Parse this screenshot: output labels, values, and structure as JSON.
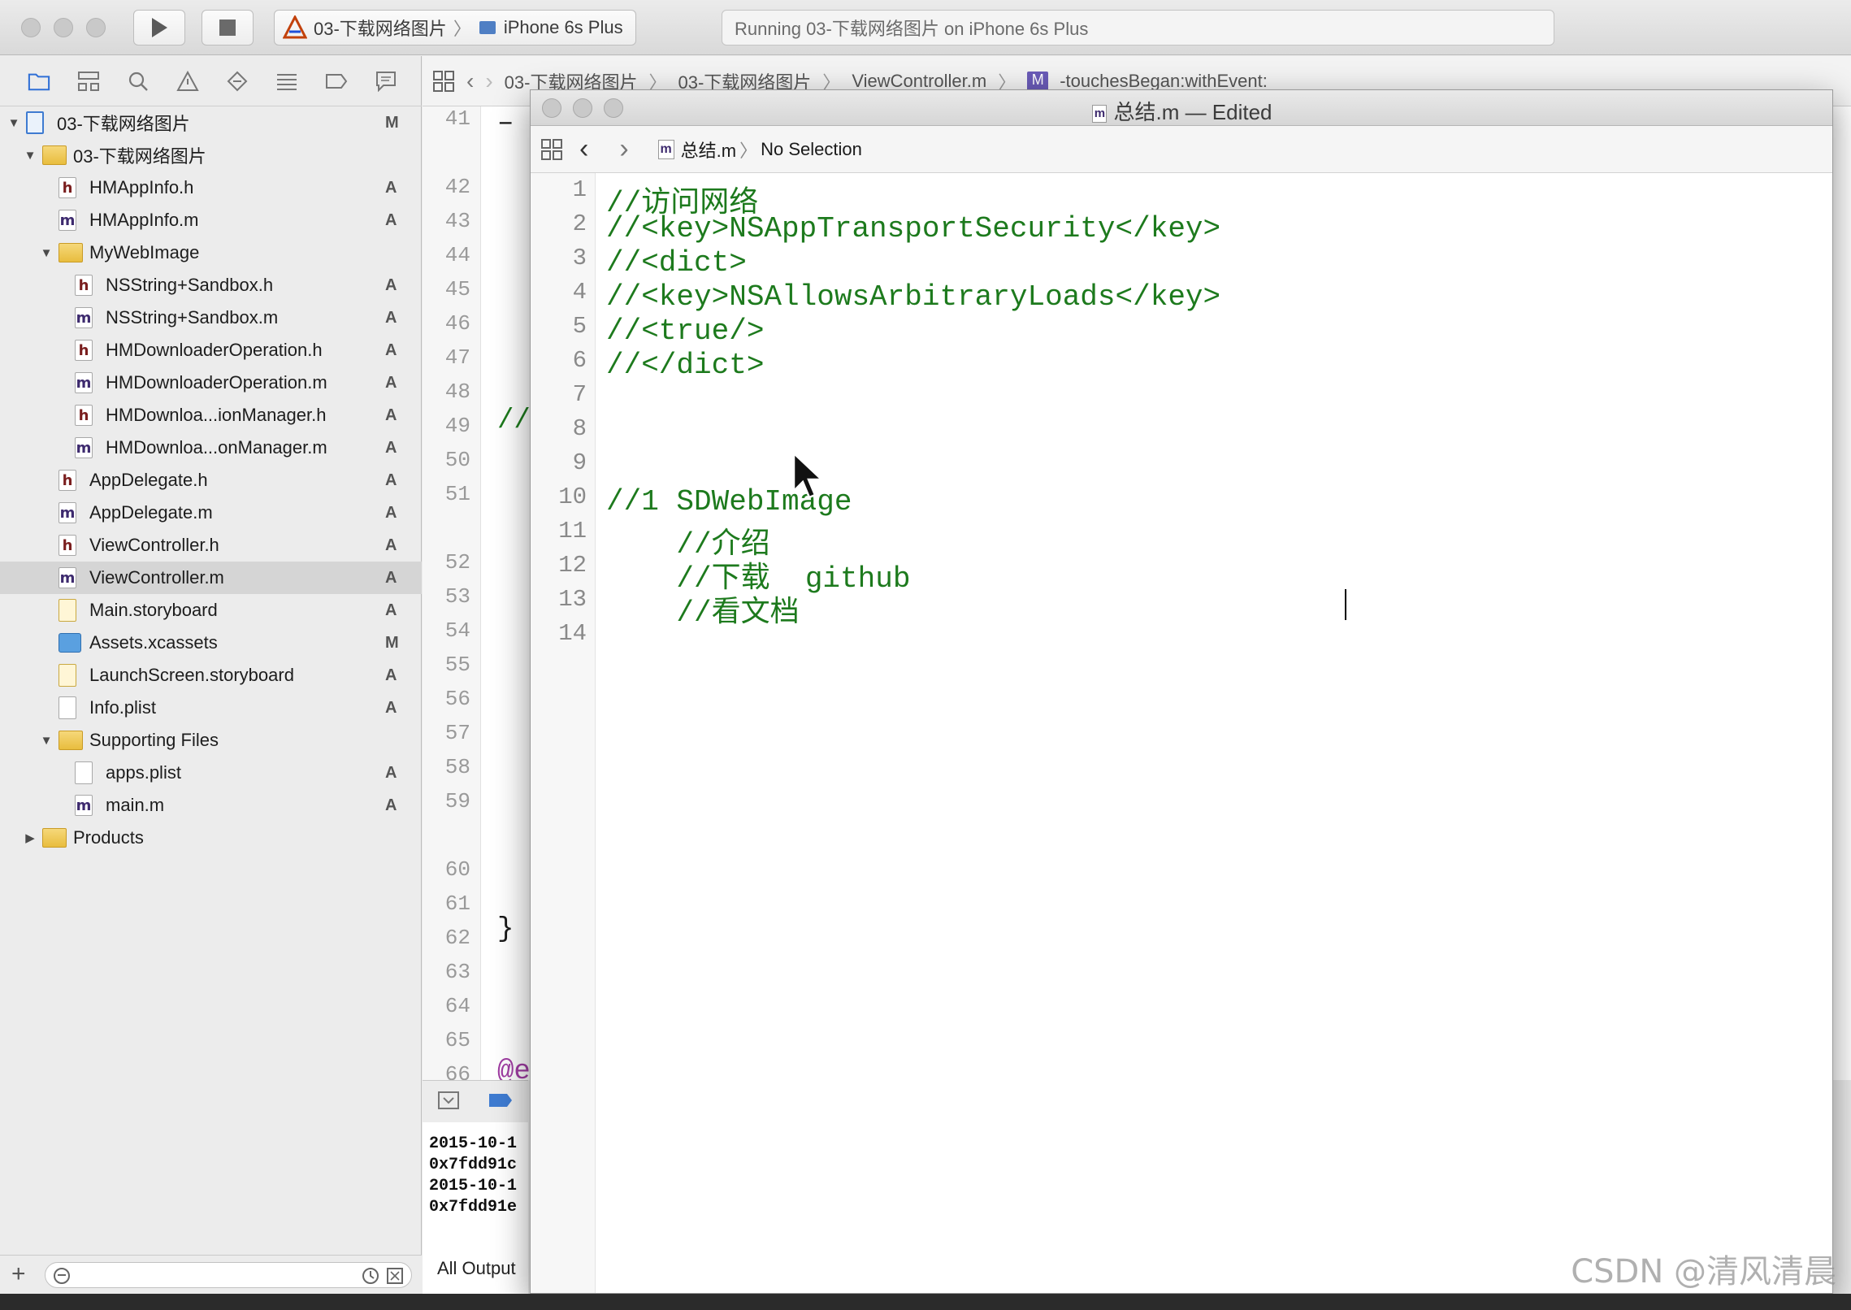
{
  "toolbar": {
    "scheme_project": "03-下载网络图片",
    "scheme_device": "iPhone 6s Plus",
    "activity_status": "Running 03-下载网络图片 on iPhone 6s Plus"
  },
  "bg_editor": {
    "jumpbar": {
      "crumbs": [
        "03-下载网络图片",
        "03-下载网络图片",
        "ViewController.m",
        "-touchesBegan:withEvent:"
      ]
    },
    "line_numbers": [
      "41",
      "42",
      "43",
      "44",
      "45",
      "46",
      "47",
      "48",
      "49",
      "50",
      "51",
      "52",
      "53",
      "54",
      "55",
      "56",
      "57",
      "58",
      "59",
      "60",
      "61",
      "62",
      "63",
      "64",
      "65",
      "66"
    ],
    "code_fragments": {
      "dash": "–",
      "comment": "//",
      "brace": "}",
      "at": "@e"
    },
    "console_lines": [
      "2015-10-1",
      "0x7fdd91c",
      "2015-10-1",
      "0x7fdd91e"
    ],
    "all_output_label": "All Output"
  },
  "navigator": {
    "tree": [
      {
        "label": "03-下载网络图片",
        "badge": "M",
        "kind": "project"
      },
      {
        "label": "03-下载网络图片",
        "badge": "",
        "kind": "folder"
      },
      {
        "label": "HMAppInfo.h",
        "badge": "A",
        "kind": "h"
      },
      {
        "label": "HMAppInfo.m",
        "badge": "A",
        "kind": "m"
      },
      {
        "label": "MyWebImage",
        "badge": "",
        "kind": "folder"
      },
      {
        "label": "NSString+Sandbox.h",
        "badge": "A",
        "kind": "h"
      },
      {
        "label": "NSString+Sandbox.m",
        "badge": "A",
        "kind": "m"
      },
      {
        "label": "HMDownloaderOperation.h",
        "badge": "A",
        "kind": "h"
      },
      {
        "label": "HMDownloaderOperation.m",
        "badge": "A",
        "kind": "m"
      },
      {
        "label": "HMDownloa...ionManager.h",
        "badge": "A",
        "kind": "h"
      },
      {
        "label": "HMDownloa...onManager.m",
        "badge": "A",
        "kind": "m"
      },
      {
        "label": "AppDelegate.h",
        "badge": "A",
        "kind": "h"
      },
      {
        "label": "AppDelegate.m",
        "badge": "A",
        "kind": "m"
      },
      {
        "label": "ViewController.h",
        "badge": "A",
        "kind": "h"
      },
      {
        "label": "ViewController.m",
        "badge": "A",
        "kind": "m"
      },
      {
        "label": "Main.storyboard",
        "badge": "A",
        "kind": "storyboard"
      },
      {
        "label": "Assets.xcassets",
        "badge": "M",
        "kind": "assets"
      },
      {
        "label": "LaunchScreen.storyboard",
        "badge": "A",
        "kind": "storyboard"
      },
      {
        "label": "Info.plist",
        "badge": "A",
        "kind": "plist"
      },
      {
        "label": "Supporting Files",
        "badge": "",
        "kind": "folder"
      },
      {
        "label": "apps.plist",
        "badge": "A",
        "kind": "plist"
      },
      {
        "label": "main.m",
        "badge": "A",
        "kind": "m"
      },
      {
        "label": "Products",
        "badge": "",
        "kind": "folder"
      }
    ]
  },
  "doc_window": {
    "title": "总结.m — Edited",
    "jump_file": "总结.m",
    "jump_selection": "No Selection",
    "line_numbers": [
      "1",
      "2",
      "3",
      "4",
      "5",
      "6",
      "7",
      "8",
      "9",
      "10",
      "11",
      "12",
      "13",
      "14"
    ],
    "code": [
      "//访问网络",
      "//<key>NSAppTransportSecurity</key>",
      "//<dict>",
      "//<key>NSAllowsArbitraryLoads</key>",
      "//<true/>",
      "//</dict>",
      "",
      "",
      "",
      "//1 SDWebImage",
      "    //介绍",
      "    //下载  github",
      "    //看文档 ",
      ""
    ],
    "code_color": "#1d7a1d"
  },
  "watermark": "CSDN @清风清晨"
}
